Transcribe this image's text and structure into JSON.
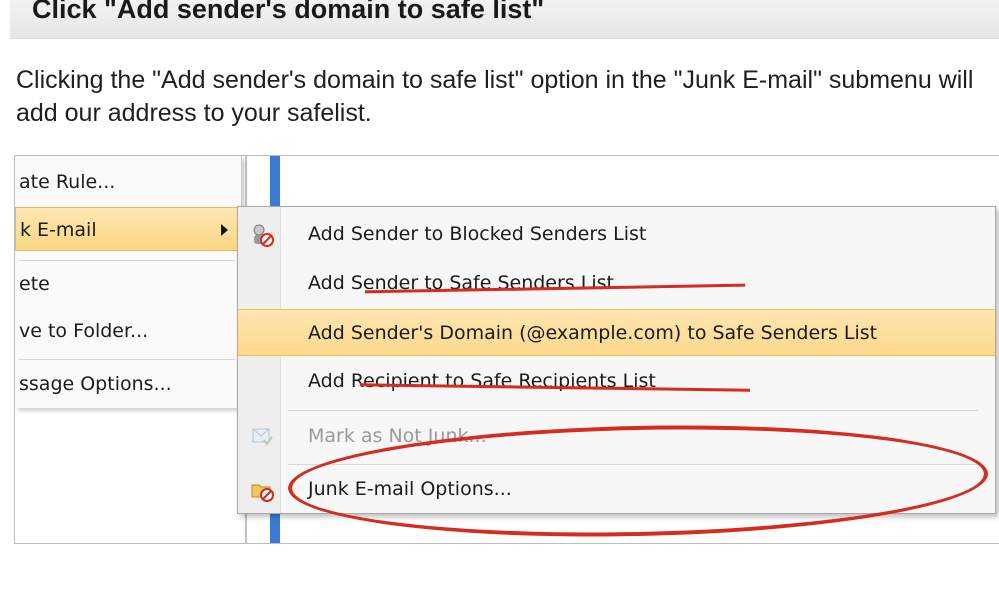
{
  "header": {
    "title": "Click \"Add sender's domain to safe list\""
  },
  "intro": {
    "text": "Clicking the \"Add sender's domain to safe list\" option in the \"Junk E-mail\" submenu will add our address to your safelist."
  },
  "left_menu": {
    "items": [
      {
        "label": "ate Rule..."
      },
      {
        "label": "k E-mail"
      },
      {
        "label": "ete"
      },
      {
        "label": "ve to Folder..."
      },
      {
        "label": "ssage Options..."
      }
    ]
  },
  "submenu": {
    "items": [
      {
        "label": "Add Sender to Blocked Senders List",
        "icon": "blocked-sender-icon"
      },
      {
        "label": "Add Sender to Safe Senders List"
      },
      {
        "label": "Add Sender's Domain (@example.com) to Safe Senders List"
      },
      {
        "label": "Add Recipient to Safe Recipients List"
      },
      {
        "label": "Mark as Not Junk...",
        "icon": "not-junk-icon"
      },
      {
        "label": "Junk E-mail Options...",
        "icon": "junk-options-icon"
      }
    ]
  },
  "colors": {
    "highlight": "#fcd98c",
    "annotation_red": "#d62b1f",
    "accent_blue": "#3a7bd5"
  }
}
